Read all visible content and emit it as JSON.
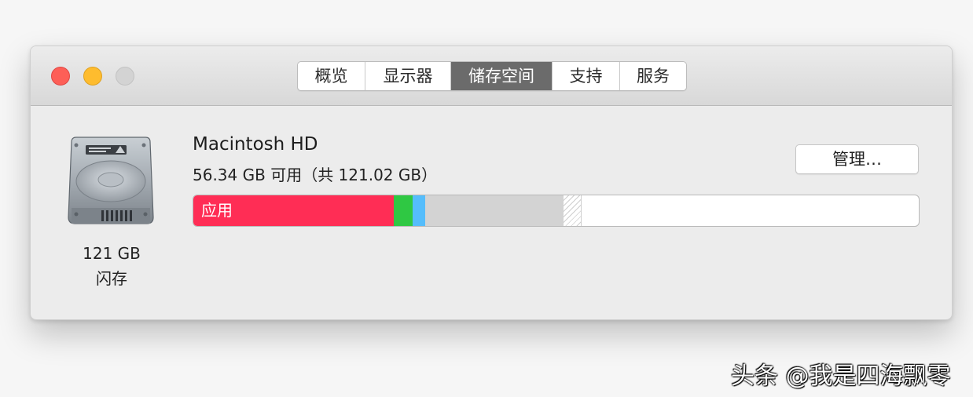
{
  "window": {
    "tabs": [
      {
        "label": "概览"
      },
      {
        "label": "显示器"
      },
      {
        "label": "储存空间"
      },
      {
        "label": "支持"
      },
      {
        "label": "服务"
      }
    ],
    "active_tab": "储存空间"
  },
  "disk": {
    "size": "121 GB",
    "type": "闪存",
    "icon": "hard-drive-icon"
  },
  "volume": {
    "name": "Macintosh HD",
    "usage": "56.34 GB 可用（共 121.02 GB）",
    "manage_label": "管理…"
  },
  "storage_bar": {
    "segments": [
      {
        "category": "应用",
        "label": "应用",
        "color": "#ff2d55"
      },
      {
        "category": "green",
        "label": "",
        "color": "#2fc843"
      },
      {
        "category": "blue",
        "label": "",
        "color": "#55bdfb"
      },
      {
        "category": "gray",
        "label": "",
        "color": "#d3d3d3"
      },
      {
        "category": "purgeable",
        "label": "",
        "color": "#cfcfcf"
      }
    ],
    "free_color": "#ffffff"
  },
  "watermark": "头条 @我是四海飘零"
}
